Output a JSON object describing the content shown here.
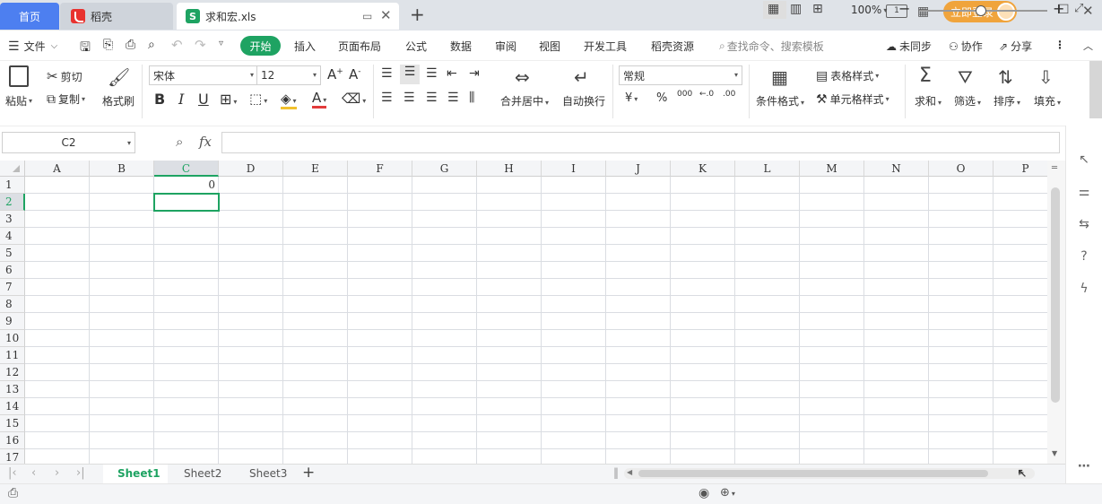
{
  "tabs": {
    "home": "首页",
    "daoke": "稻壳",
    "file": "求和宏.xls",
    "file_logo": "S"
  },
  "titlebar": {
    "login": "立即登录",
    "page_indicator": "1"
  },
  "menu": {
    "file": "文件",
    "items": [
      "开始",
      "插入",
      "页面布局",
      "公式",
      "数据",
      "审阅",
      "视图",
      "开发工具",
      "稻壳资源"
    ],
    "search": "查找命令、搜索模板",
    "sync": "未同步",
    "collab": "协作",
    "share": "分享"
  },
  "ribbon": {
    "paste": "粘贴",
    "cut": "剪切",
    "copy": "复制",
    "format_painter": "格式刷",
    "font_name": "宋体",
    "font_size": "12",
    "number_format": "常规",
    "merge_center": "合并居中",
    "wrap_text": "自动换行",
    "conditional_format": "条件格式",
    "table_style": "表格样式",
    "cell_style": "单元格样式",
    "sum": "求和",
    "filter": "筛选",
    "sort": "排序",
    "fill": "填充",
    "currency": "¥",
    "percent": "%",
    "thousands": "000",
    "dec_inc": "←.0",
    "dec_dec": ".00",
    "bold": "B",
    "italic": "I",
    "underline": "U",
    "font_color_letter": "A",
    "grow_font": "A",
    "shrink_font": "A"
  },
  "formula": {
    "cell_ref": "C2",
    "fx": "fx",
    "value": ""
  },
  "grid": {
    "columns": [
      "A",
      "B",
      "C",
      "D",
      "E",
      "F",
      "G",
      "H",
      "I",
      "J",
      "K",
      "L",
      "M",
      "N",
      "O",
      "P"
    ],
    "rows": [
      "1",
      "2",
      "3",
      "4",
      "5",
      "6",
      "7",
      "8",
      "9",
      "10",
      "11",
      "12",
      "13",
      "14",
      "15",
      "16",
      "17"
    ],
    "cells": {
      "C1": "0"
    },
    "selected": "C2"
  },
  "sheets": [
    "Sheet1",
    "Sheet2",
    "Sheet3"
  ],
  "active_sheet": "Sheet1",
  "status": {
    "zoom": "100%"
  },
  "colors": {
    "accent": "#1ea362",
    "home_tab": "#4d7ff0",
    "login": "#f0a43c"
  }
}
